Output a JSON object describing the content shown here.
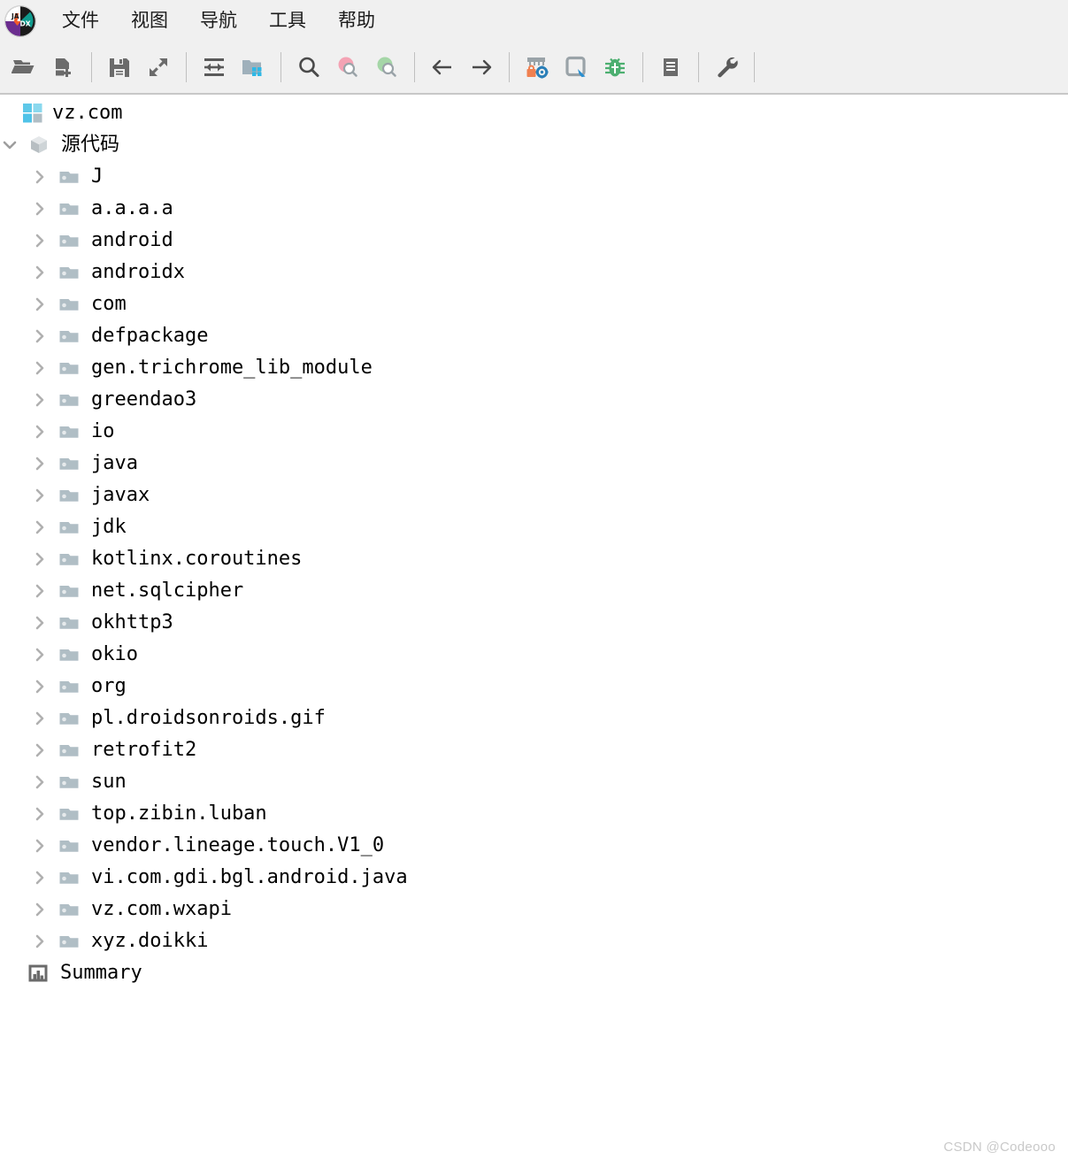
{
  "app": {
    "name": "jadx-gui",
    "logo_icon": "jadx-logo-icon"
  },
  "menubar": {
    "items": [
      {
        "label": "文件",
        "name": "menu-file"
      },
      {
        "label": "视图",
        "name": "menu-view"
      },
      {
        "label": "导航",
        "name": "menu-navigation"
      },
      {
        "label": "工具",
        "name": "menu-tools"
      },
      {
        "label": "帮助",
        "name": "menu-help"
      }
    ]
  },
  "toolbar": {
    "buttons": [
      {
        "icon": "open-folder-icon",
        "name": "open-file-button"
      },
      {
        "icon": "add-file-icon",
        "name": "add-files-button"
      },
      {
        "sep": true
      },
      {
        "icon": "save-icon",
        "name": "save-all-button"
      },
      {
        "icon": "export-icon",
        "name": "export-gradle-project-button"
      },
      {
        "sep": true
      },
      {
        "icon": "sync-icon",
        "name": "sync-button"
      },
      {
        "icon": "flat-packages-icon",
        "name": "flat-packages-button"
      },
      {
        "sep": true
      },
      {
        "icon": "search-icon",
        "name": "text-search-button"
      },
      {
        "icon": "search-class-icon",
        "name": "class-search-button"
      },
      {
        "icon": "search-comment-icon",
        "name": "comment-search-button"
      },
      {
        "sep": true
      },
      {
        "icon": "back-arrow-icon",
        "name": "navigate-back-button"
      },
      {
        "icon": "forward-arrow-icon",
        "name": "navigate-forward-button"
      },
      {
        "sep": true
      },
      {
        "icon": "deobfuscation-icon",
        "name": "deobfuscation-button"
      },
      {
        "icon": "quark-icon",
        "name": "quark-engine-button"
      },
      {
        "icon": "bug-icon",
        "name": "open-logs-button"
      },
      {
        "sep": true
      },
      {
        "icon": "log-icon",
        "name": "log-viewer-button"
      },
      {
        "sep": true
      },
      {
        "icon": "wrench-icon",
        "name": "preferences-button"
      },
      {
        "sep": true
      }
    ]
  },
  "tree": {
    "root": {
      "label": "vz.com",
      "icon": "apk-grid-icon",
      "expanded": true
    },
    "source_node": {
      "label": "源代码",
      "icon": "cube-icon",
      "expanded": true
    },
    "packages": [
      "J",
      "a.a.a.a",
      "android",
      "androidx",
      "com",
      "defpackage",
      "gen.trichrome_lib_module",
      "greendao3",
      "io",
      "java",
      "javax",
      "jdk",
      "kotlinx.coroutines",
      "net.sqlcipher",
      "okhttp3",
      "okio",
      "org",
      "pl.droidsonroids.gif",
      "retrofit2",
      "sun",
      "top.zibin.luban",
      "vendor.lineage.touch.V1_0",
      "vi.com.gdi.bgl.android.java",
      "vz.com.wxapi",
      "xyz.doikki"
    ],
    "summary": {
      "label": "Summary",
      "icon": "summary-icon"
    }
  },
  "watermark": {
    "text": "CSDN @Codeooo"
  },
  "colors": {
    "chrome_bg": "#f0f0f0",
    "content_bg": "#ffffff",
    "folder": "#b0bec5",
    "twisty": "#b0b0b0",
    "accent_cyan": "#4fc3e8",
    "bug_green": "#4caf70",
    "lock_orange": "#f08050",
    "gear_blue": "#2a7fb8",
    "pink": "#f4a3b4",
    "green": "#a5d6a7",
    "text": "#000000"
  }
}
